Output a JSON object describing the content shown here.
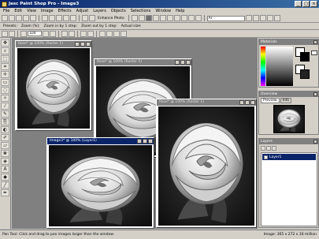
{
  "window": {
    "title": "Jasc Paint Shop Pro - Image3"
  },
  "menu": [
    "File",
    "Edit",
    "View",
    "Image",
    "Effects",
    "Adjust",
    "Layers",
    "Objects",
    "Selections",
    "Window",
    "Help"
  ],
  "toolbar": {
    "enhance_label": "Enhance Photo",
    "font_dropdown": "Ar",
    "presets_label": "Presets:",
    "zoom_pct_label": "Zoom (%):",
    "zoom_value": "100",
    "zoom_in_label": "Zoom in by 1 step:",
    "zoom_out_label": "Zoom out by 1 step:",
    "actual_size_label": "Actual size:"
  },
  "documents": [
    {
      "title": "Rose* @ 100% (Raster 1)"
    },
    {
      "title": "Rose* @ 100% (Raster 1)"
    },
    {
      "title": "Rose* @ 100% (Raster 1)"
    },
    {
      "title": "Image3* @ 100% (Layer1)"
    }
  ],
  "palettes": {
    "materials": {
      "title": "Materials"
    },
    "overview": {
      "title": "Overview",
      "tab_preview": "Preview",
      "tab_info": "Info"
    },
    "layers": {
      "title": "Layers",
      "layer_name": "Layer1"
    }
  },
  "status": {
    "left": "Pan Tool: Click and drag to pan images larger than the window.",
    "right": "Image:  365 x 272 x 16 million"
  },
  "colors": {
    "title_active": "#0a246a",
    "title_inactive": "#808080",
    "workspace": "#808080",
    "chrome": "#d4d0c8"
  }
}
